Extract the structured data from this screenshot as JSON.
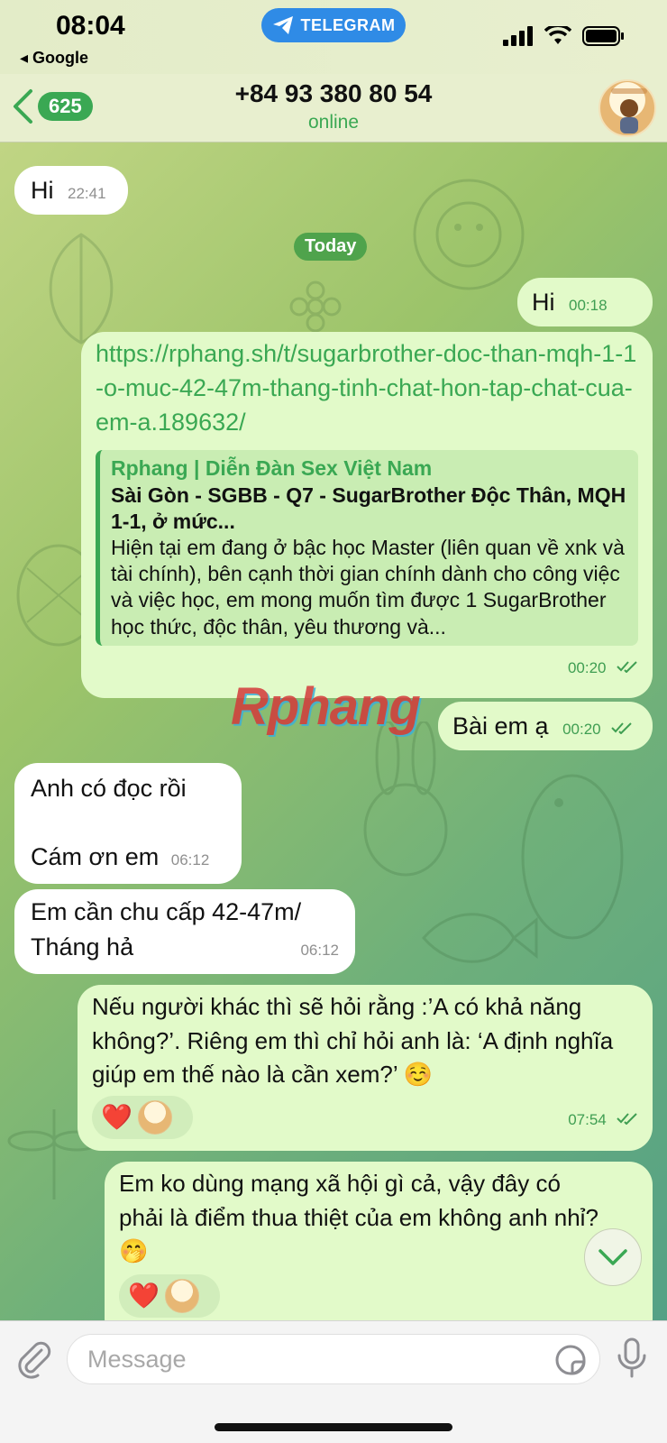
{
  "status_bar": {
    "time": "08:04",
    "back_app": "◂ Google",
    "pill_label": "TELEGRAM"
  },
  "header": {
    "unread_count": "625",
    "contact_name": "+84 93 380 80 54",
    "contact_status": "online"
  },
  "date_separator": "Today",
  "messages": [
    {
      "dir": "in",
      "text": "Hi",
      "time": "22:41"
    },
    {
      "dir": "out",
      "text": "Hi",
      "time": "00:18"
    },
    {
      "dir": "out",
      "link": "https://rphang.sh/t/sugarbrother-doc-than-mqh-1-1-o-muc-42-47m-thang-tinh-chat-hon-tap-chat-cua-em-a.189632/",
      "preview": {
        "site": "Rphang | Diễn Đàn Sex Việt Nam",
        "title": "Sài Gòn - SGBB - Q7 - SugarBrother Độc Thân, MQH 1-1, ở mức...",
        "description": "Hiện tại em đang ở bậc học Master (liên quan về xnk và tài chính), bên cạnh thời gian chính dành cho công việc và việc học, em mong muốn tìm được 1 SugarBrother học thức, độc thân, yêu thương và..."
      },
      "time": "00:20"
    },
    {
      "dir": "out",
      "text": "Bài em ạ",
      "time": "00:20"
    },
    {
      "dir": "in",
      "line1": "Anh có đọc rồi",
      "line2": "Cám ơn em",
      "time": "06:12"
    },
    {
      "dir": "in",
      "line1": "Em cần chu cấp 42-47m/",
      "line2": "Tháng hả",
      "time": "06:12"
    },
    {
      "dir": "out",
      "text": "Nếu người khác thì sẽ hỏi rằng :’A có khả năng không?’. Riêng em thì chỉ hỏi anh là: ‘A định nghĩa giúp em thế nào là cần xem?’ ☺️",
      "reaction": "❤️",
      "time": "07:54"
    },
    {
      "dir": "out",
      "text": "Em ko dùng mạng xã hội gì cả, vậy đây có phải là điểm thua thiệt của em không anh nhỉ? 🤭",
      "reaction": "❤️"
    }
  ],
  "watermark": "Rphang",
  "input": {
    "placeholder": "Message"
  }
}
